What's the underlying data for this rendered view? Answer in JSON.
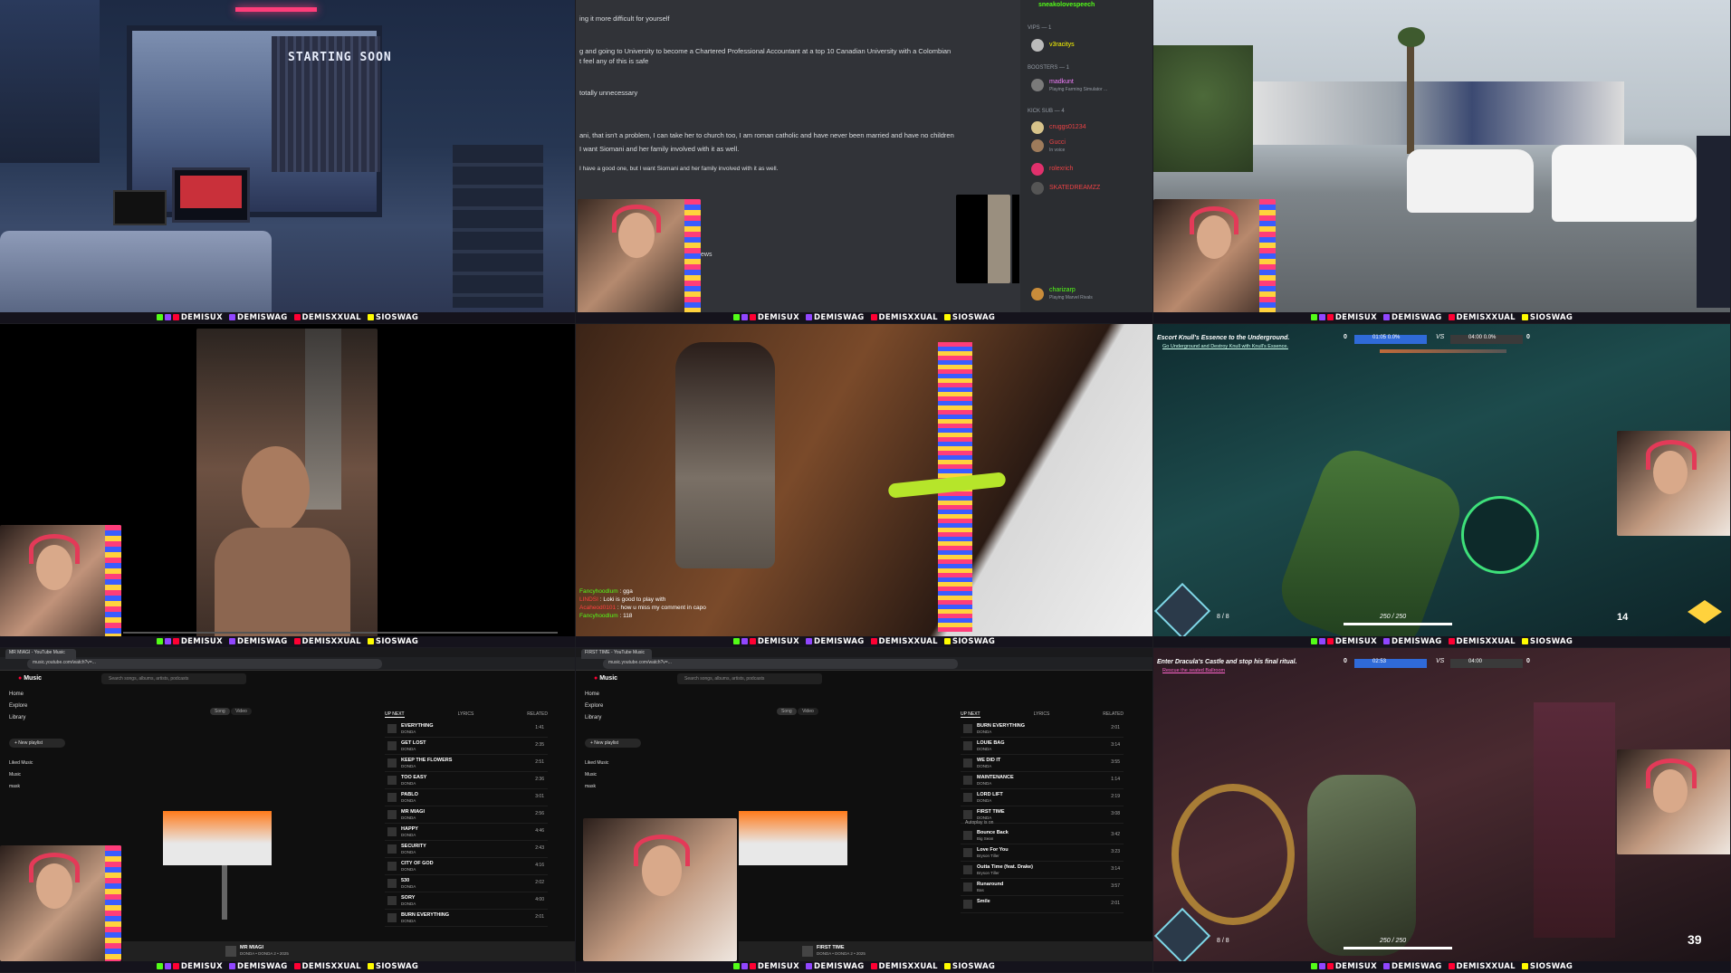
{
  "banner": [
    {
      "platform": "kick",
      "label": "DEMISUX"
    },
    {
      "platform": "twitch",
      "label": "DEMISWAG"
    },
    {
      "platform": "youtube",
      "label": "DEMISXXUAL"
    },
    {
      "platform": "snapchat",
      "label": "SIOSWAG"
    }
  ],
  "colors": {
    "kick": "#53fc18",
    "twitch": "#9146ff",
    "youtube": "#ff0033",
    "snapchat": "#fffc00",
    "headset": "#e33a58"
  },
  "tile1": {
    "sign": "STARTING SOON"
  },
  "tile2": {
    "messages": [
      "ing it more difficult for yourself",
      "g and going to University to become a Chartered Professional Accountant at a top 10 Canadian University with a Colombian",
      "t feel any of this is safe",
      "totally unnecessary",
      "ani, that isn't a problem, I can take her to church too, I am roman catholic  and have never been married and have no children",
      "I want Siomani and her family involved with it as well.",
      "I have a good one, but I want Siomani and her family involved with it as well."
    ],
    "side_word": "ews",
    "members": {
      "top_user": "sneakolovespeech",
      "vips_label": "VIPS — 1",
      "vip_user": "v3racitys",
      "boosters_label": "BOOSTERS — 1",
      "booster_user": "madkunt",
      "booster_status": "Playing Farming Simulator ...",
      "kicksub_label": "KICK SUB — 4",
      "subs": [
        {
          "name": "cruggs01234",
          "status": ""
        },
        {
          "name": "Gucci",
          "status": "In voice"
        },
        {
          "name": "rolexrich",
          "status": ""
        },
        {
          "name": "SKATEDREAMZZ",
          "status": ""
        }
      ],
      "bottom_user": "charizarp",
      "bottom_status": "Playing Marvel Rivals"
    }
  },
  "tile5": {
    "chat": [
      {
        "user": "Fancyhoodlum",
        "msg": "gga"
      },
      {
        "user": "LINDSI",
        "msg": "Loki is good to play with"
      },
      {
        "user": "Acaheod0101",
        "msg": "how u miss my comment in capo"
      },
      {
        "user": "Fancyhoodlum",
        "msg": "118"
      }
    ]
  },
  "tile6": {
    "objective_title": "Escort Knull's Essence to the Underground.",
    "objective_sub": "Go Underground and Destroy Knull with Knull's Essence.",
    "left_score": "0",
    "right_score": "0",
    "left_pct": "0.0%",
    "right_pct": "0.0%",
    "timer_left": "01:05",
    "timer_right": "04:00",
    "vs": "VS",
    "hp": "250 / 250",
    "ammo": "8 / 8",
    "ult": "14"
  },
  "tile9": {
    "objective_title": "Enter Dracula's Castle and stop his final ritual.",
    "objective_sub": "Rescue the seated Ballroom",
    "left_score": "0",
    "right_score": "0",
    "timer_left": "02:53",
    "timer_right": "04:00",
    "vs": "VS",
    "hp": "250 / 250",
    "ammo": "8 / 8",
    "ult": "39"
  },
  "yt_common": {
    "logo": "Music",
    "search_placeholder": "Search songs, albums, artists, podcasts",
    "nav": [
      "Home",
      "Explore",
      "Library"
    ],
    "new_playlist": "+ New playlist",
    "library_items": [
      "Liked Music",
      "Music",
      "mask"
    ],
    "tabs": [
      "UP NEXT",
      "LYRICS",
      "RELATED"
    ],
    "chips": [
      "Song",
      "Video"
    ]
  },
  "tile7": {
    "tab_title": "MR MIAGI - YouTube Music",
    "url": "music.youtube.com/watch?v=...",
    "queue": [
      {
        "title": "EVERYTHING",
        "album": "DONDA",
        "dur": "1:41"
      },
      {
        "title": "GET LOST",
        "album": "DONDA",
        "dur": "2:35"
      },
      {
        "title": "KEEP THE FLOWERS",
        "album": "DONDA",
        "dur": "2:51"
      },
      {
        "title": "TOO EASY",
        "album": "DONDA",
        "dur": "2:36"
      },
      {
        "title": "PABLO",
        "album": "DONDA",
        "dur": "3:01"
      },
      {
        "title": "MR MIAGI",
        "album": "DONDA",
        "dur": "2:56"
      },
      {
        "title": "HAPPY",
        "album": "DONDA",
        "dur": "4:46"
      },
      {
        "title": "SECURITY",
        "album": "DONDA",
        "dur": "2:43"
      },
      {
        "title": "CITY OF GOD",
        "album": "DONDA",
        "dur": "4:16"
      },
      {
        "title": "530",
        "album": "DONDA",
        "dur": "2:02"
      },
      {
        "title": "SORY",
        "album": "DONDA",
        "dur": "4:00"
      },
      {
        "title": "BURN EVERYTHING",
        "album": "DONDA",
        "dur": "2:01"
      }
    ],
    "now_title": "MR MIAGI",
    "now_sub": "DONDA • DONDA 2 • 2025"
  },
  "tile8": {
    "tab_title": "FIRST TIME - YouTube Music",
    "url": "music.youtube.com/watch?v=...",
    "queue": [
      {
        "title": "BURN EVERYTHING",
        "album": "DONDA",
        "dur": "2:01"
      },
      {
        "title": "LOUIE BAG",
        "album": "DONDA",
        "dur": "3:14"
      },
      {
        "title": "WE DID IT",
        "album": "DONDA",
        "dur": "3:55"
      },
      {
        "title": "MAINTENANCE",
        "album": "DONDA",
        "dur": "1:14"
      },
      {
        "title": "LORD LIFT",
        "album": "DONDA",
        "dur": "2:19"
      },
      {
        "title": "FIRST TIME",
        "album": "DONDA",
        "dur": "3:08"
      }
    ],
    "autoplay_label": "Autoplay is on",
    "autoplay": [
      {
        "title": "Bounce Back",
        "album": "Big Sean",
        "dur": "3:42"
      },
      {
        "title": "Love For You",
        "album": "Bryson Tiller",
        "dur": "3:23"
      },
      {
        "title": "Outta Time (feat. Drake)",
        "album": "Bryson Tiller",
        "dur": "3:14"
      },
      {
        "title": "Runaround",
        "album": "Bas",
        "dur": "3:57"
      },
      {
        "title": "Smile",
        "album": "",
        "dur": "2:01"
      }
    ],
    "now_title": "FIRST TIME",
    "now_sub": "DONDA • DONDA 2 • 2025"
  }
}
